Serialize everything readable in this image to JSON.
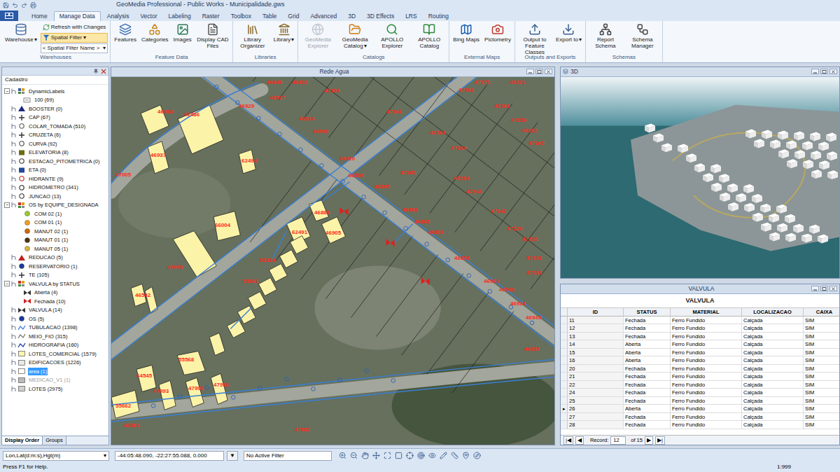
{
  "window": {
    "title": "GeoMedia Professional - Public Works - Municipalidade.gws"
  },
  "ribbon_tabs": [
    {
      "label": "Home",
      "selected": false
    },
    {
      "label": "Manage Data",
      "selected": true
    },
    {
      "label": "Analysis",
      "selected": false
    },
    {
      "label": "Vector",
      "selected": false
    },
    {
      "label": "Labeling",
      "selected": false
    },
    {
      "label": "Raster",
      "selected": false
    },
    {
      "label": "Toolbox",
      "selected": false
    },
    {
      "label": "Table",
      "selected": false
    },
    {
      "label": "Grid",
      "selected": false
    },
    {
      "label": "Advanced",
      "selected": false
    },
    {
      "label": "3D",
      "selected": false
    },
    {
      "label": "3D Effects",
      "selected": false
    },
    {
      "label": "LRS",
      "selected": false
    },
    {
      "label": "Routing",
      "selected": false
    }
  ],
  "ribbon_groups": [
    {
      "label": "Warehouses",
      "buttons": [
        {
          "label": "Warehouse",
          "arrow": "▾",
          "kind": "large",
          "disabled": false,
          "highlighted": false
        },
        {
          "label": "Refresh with Changes",
          "kind": "small",
          "disabled": false,
          "highlighted": false
        },
        {
          "label": "Spatial Filter",
          "arrow": "▾",
          "kind": "small",
          "disabled": false,
          "highlighted": true
        },
        {
          "label": "< Spatial Filter Name >",
          "arrow": "▾",
          "kind": "combo",
          "disabled": false,
          "highlighted": false
        }
      ]
    },
    {
      "label": "Feature Data",
      "buttons": [
        {
          "label": "Features",
          "kind": "large",
          "disabled": false,
          "highlighted": false
        },
        {
          "label": "Categories",
          "kind": "large",
          "disabled": false,
          "highlighted": false
        },
        {
          "label": "Images",
          "kind": "large",
          "disabled": false,
          "highlighted": false
        },
        {
          "label": "Display CAD Files",
          "kind": "large",
          "disabled": false,
          "highlighted": false
        }
      ]
    },
    {
      "label": "Libraries",
      "buttons": [
        {
          "label": "Library Organizer",
          "kind": "large",
          "disabled": false,
          "highlighted": false
        },
        {
          "label": "Library",
          "arrow": "▾",
          "kind": "large",
          "disabled": false,
          "highlighted": false
        }
      ]
    },
    {
      "label": "Catalogs",
      "buttons": [
        {
          "label": "GeoMedia Explorer",
          "kind": "large",
          "disabled": true,
          "highlighted": false
        },
        {
          "label": "GeoMedia Catalog",
          "arrow": "▾",
          "kind": "large",
          "disabled": false,
          "highlighted": false
        },
        {
          "label": "APOLLO Explorer",
          "kind": "large",
          "disabled": false,
          "highlighted": false
        },
        {
          "label": "APOLLO Catalog",
          "kind": "large",
          "disabled": false,
          "highlighted": false
        }
      ]
    },
    {
      "label": "External Maps",
      "buttons": [
        {
          "label": "Bing Maps",
          "kind": "large",
          "disabled": false,
          "highlighted": false
        },
        {
          "label": "Pictometry",
          "kind": "large",
          "disabled": false,
          "highlighted": false
        }
      ]
    },
    {
      "label": "Outputs and Exports",
      "buttons": [
        {
          "label": "Output to Feature Classes",
          "kind": "large",
          "disabled": false,
          "highlighted": false
        },
        {
          "label": "Export to",
          "arrow": "▾",
          "kind": "large",
          "disabled": false,
          "highlighted": false
        }
      ]
    },
    {
      "label": "Schemas",
      "buttons": [
        {
          "label": "Report Schema",
          "kind": "large",
          "disabled": false,
          "highlighted": false
        },
        {
          "label": "Schema Manager",
          "kind": "large",
          "disabled": false,
          "highlighted": false
        }
      ]
    }
  ],
  "legend": {
    "title": "Cadastro",
    "items": [
      {
        "label": "DynamicLabels",
        "kind": "header",
        "toggle": "−",
        "child": false,
        "selected": false,
        "dimmed": false,
        "color": "#3a5fa0"
      },
      {
        "label": "100 (69)",
        "kind": "label",
        "child": true,
        "selected": false,
        "dimmed": false,
        "color": "#666666"
      },
      {
        "label": "BOOSTER (0)",
        "kind": "triangle",
        "child": false,
        "selected": false,
        "dimmed": false,
        "color": "#1b2a80"
      },
      {
        "label": "CAP (67)",
        "kind": "cross",
        "child": false,
        "selected": false,
        "dimmed": false,
        "color": "#333333"
      },
      {
        "label": "COLAR_TOMADA (510)",
        "kind": "ring",
        "child": false,
        "selected": false,
        "dimmed": false,
        "color": "#555555"
      },
      {
        "label": "CRUZETA (6)",
        "kind": "cross",
        "child": false,
        "selected": false,
        "dimmed": false,
        "color": "#333333"
      },
      {
        "label": "CURVA (92)",
        "kind": "ring",
        "child": false,
        "selected": false,
        "dimmed": false,
        "color": "#444444"
      },
      {
        "label": "ELEVATORIA (8)",
        "kind": "square",
        "child": false,
        "selected": false,
        "dimmed": false,
        "color": "#6b6b12"
      },
      {
        "label": "ESTACAO_PITOMETRICA (0)",
        "kind": "ring",
        "child": false,
        "selected": false,
        "dimmed": false,
        "color": "#333333"
      },
      {
        "label": "ETA (0)",
        "kind": "square",
        "child": false,
        "selected": false,
        "dimmed": false,
        "color": "#23479c"
      },
      {
        "label": "HIDRANTE (9)",
        "kind": "ring",
        "child": false,
        "selected": false,
        "dimmed": false,
        "color": "#c02222"
      },
      {
        "label": "HIDROMETRO (341)",
        "kind": "ring",
        "child": false,
        "selected": false,
        "dimmed": false,
        "color": "#222222"
      },
      {
        "label": "JUNCAO (13)",
        "kind": "ring",
        "child": false,
        "selected": false,
        "dimmed": false,
        "color": "#333333"
      },
      {
        "label": "OS by EQUIPE_DESIGNADA",
        "kind": "header",
        "toggle": "−",
        "child": false,
        "selected": false,
        "dimmed": false,
        "color": "#c03030"
      },
      {
        "label": "COM 02 (1)",
        "kind": "dot",
        "child": true,
        "selected": false,
        "dimmed": false,
        "color": "#9acd32"
      },
      {
        "label": "COM 01 (1)",
        "kind": "dot",
        "child": true,
        "selected": false,
        "dimmed": false,
        "color": "#f0a020"
      },
      {
        "label": "MANUT 02 (1)",
        "kind": "dot",
        "child": true,
        "selected": false,
        "dimmed": false,
        "color": "#d06a00"
      },
      {
        "label": "MANUT 01 (1)",
        "kind": "dot",
        "child": true,
        "selected": false,
        "dimmed": false,
        "color": "#4a3410"
      },
      {
        "label": "MANUT 05 (1)",
        "kind": "dot",
        "child": true,
        "selected": false,
        "dimmed": false,
        "color": "#d8b840"
      },
      {
        "label": "REDUCAO (5)",
        "kind": "triangle",
        "child": false,
        "selected": false,
        "dimmed": false,
        "color": "#c02020"
      },
      {
        "label": "RESERVATORIO (1)",
        "kind": "dot",
        "child": false,
        "selected": false,
        "dimmed": false,
        "color": "#1a3a9a"
      },
      {
        "label": "TE (105)",
        "kind": "cross",
        "child": false,
        "selected": false,
        "dimmed": false,
        "color": "#333333"
      },
      {
        "label": "VALVULA by STATUS",
        "kind": "header",
        "toggle": "−",
        "child": false,
        "selected": false,
        "dimmed": false,
        "color": "#c03030"
      },
      {
        "label": "Aberta (4)",
        "kind": "bowtie",
        "child": true,
        "selected": false,
        "dimmed": false,
        "color": "#333333"
      },
      {
        "label": "Fechada (10)",
        "kind": "bowtie",
        "child": true,
        "selected": false,
        "dimmed": false,
        "color": "#d02020"
      },
      {
        "label": "VALVULA (14)",
        "kind": "bowtie",
        "child": false,
        "selected": false,
        "dimmed": false,
        "color": "#333333"
      },
      {
        "label": "OS (5)",
        "kind": "dot",
        "child": false,
        "selected": false,
        "dimmed": false,
        "color": "#1a3a9a"
      },
      {
        "label": "TUBULACAO (1398)",
        "kind": "line",
        "child": false,
        "selected": false,
        "dimmed": false,
        "color": "#3a7fd5"
      },
      {
        "label": "MEIO_FIO (315)",
        "kind": "line",
        "child": false,
        "selected": false,
        "dimmed": false,
        "color": "#777777"
      },
      {
        "label": "HIDROGRAFIA (160)",
        "kind": "line",
        "child": false,
        "selected": false,
        "dimmed": false,
        "color": "#1a3a9a"
      },
      {
        "label": "LOTES_COMERCIAL (1579)",
        "kind": "area",
        "child": false,
        "selected": false,
        "dimmed": false,
        "color": "#fdf5b0"
      },
      {
        "label": "EDIFICACOES (1226)",
        "kind": "area",
        "child": false,
        "selected": false,
        "dimmed": false,
        "color": "#e8e8e8"
      },
      {
        "label": "area (1)",
        "kind": "area",
        "child": false,
        "selected": true,
        "dimmed": false,
        "color": "#ffffff"
      },
      {
        "label": "MEDICAO_V1 (1)",
        "kind": "area",
        "child": false,
        "selected": false,
        "dimmed": true,
        "color": "#bbbbbb"
      },
      {
        "label": "LOTES (2975)",
        "kind": "area",
        "child": false,
        "selected": false,
        "dimmed": false,
        "color": "#cfcfcf"
      }
    ],
    "tabs": [
      {
        "label": "Display Order",
        "selected": true
      },
      {
        "label": "Groups",
        "selected": false
      }
    ]
  },
  "map_window": {
    "title": "Rede Agua",
    "labels": [
      "46948",
      "62486",
      "46937",
      "62494",
      "47005",
      "66004",
      "62491",
      "46905",
      "46888",
      "55334",
      "55661",
      "47075",
      "46542",
      "55662",
      "64545",
      "55568",
      "47993",
      "47992",
      "47916",
      "47861",
      "47887",
      "46949",
      "46927",
      "46929",
      "46932",
      "47303",
      "46914",
      "46906",
      "46920",
      "46898",
      "46995",
      "46881",
      "46885",
      "46883",
      "46858",
      "46961",
      "46966",
      "46934",
      "46945",
      "46957",
      "47261",
      "47263",
      "47264",
      "47280",
      "47284",
      "47248",
      "47242",
      "47229",
      "47235",
      "47238",
      "47233",
      "47266",
      "47270",
      "47271",
      "47261",
      "47256",
      "47262",
      "47265"
    ]
  },
  "view3d": {
    "title": "3D"
  },
  "table_window": {
    "title": "VALVULA",
    "caption": "VALVULA",
    "current_marker": "▸",
    "columns": [
      "ID",
      "STATUS",
      "MATERIAL",
      "LOCALIZACAO",
      "CAIXA"
    ],
    "rows": [
      {
        "cells": [
          "11",
          "Fechada",
          "Ferro Fundido",
          "Calçada",
          "SIM"
        ],
        "current": false
      },
      {
        "cells": [
          "12",
          "Fechada",
          "Ferro Fundido",
          "Calçada",
          "SIM"
        ],
        "current": false
      },
      {
        "cells": [
          "13",
          "Fechada",
          "Ferro Fundido",
          "Calçada",
          "SIM"
        ],
        "current": false
      },
      {
        "cells": [
          "14",
          "Aberta",
          "Ferro Fundido",
          "Calçada",
          "SIM"
        ],
        "current": false
      },
      {
        "cells": [
          "15",
          "Aberta",
          "Ferro Fundido",
          "Calçada",
          "SIM"
        ],
        "current": false
      },
      {
        "cells": [
          "16",
          "Aberta",
          "Ferro Fundido",
          "Calçada",
          "SIM"
        ],
        "current": false
      },
      {
        "cells": [
          "20",
          "Fechada",
          "Ferro Fundido",
          "Calçada",
          "SIM"
        ],
        "current": false
      },
      {
        "cells": [
          "21",
          "Fechada",
          "Ferro Fundido",
          "Calçada",
          "SIM"
        ],
        "current": false
      },
      {
        "cells": [
          "22",
          "Fechada",
          "Ferro Fundido",
          "Calçada",
          "SIM"
        ],
        "current": false
      },
      {
        "cells": [
          "24",
          "Fechada",
          "Ferro Fundido",
          "Calçada",
          "SIM"
        ],
        "current": false
      },
      {
        "cells": [
          "25",
          "Fechada",
          "Ferro Fundido",
          "Calçada",
          "SIM"
        ],
        "current": false
      },
      {
        "cells": [
          "26",
          "Aberta",
          "Ferro Fundido",
          "Calçada",
          "SIM"
        ],
        "current": true
      },
      {
        "cells": [
          "27",
          "Fechada",
          "Ferro Fundido",
          "Calçada",
          "SIM"
        ],
        "current": false
      },
      {
        "cells": [
          "28",
          "Fechada",
          "Ferro Fundido",
          "Calçada",
          "SIM"
        ],
        "current": false
      }
    ],
    "nav": {
      "buttons_left": [
        "|◀",
        "◀"
      ],
      "label": "Record:",
      "record": "12",
      "total": "of 15",
      "buttons_right": [
        "▶",
        "▶|"
      ]
    }
  },
  "status_bar": {
    "coord_system": "Lon,Lat(d:m:s),Hgt(m)",
    "coord_arrow": "▾",
    "coordinates": "-44:05:48.090, -22:27:55.088, 0.000",
    "coord_button": "▼",
    "filter": "No Active Filter",
    "help": "Press F1 for Help.",
    "scale": "1:999"
  }
}
